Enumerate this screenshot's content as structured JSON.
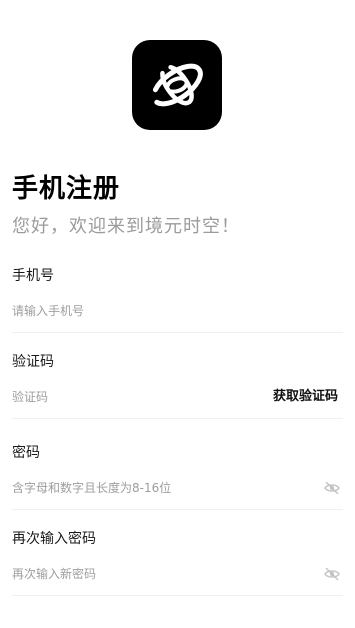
{
  "app": {
    "logo_icon": "orbit-logo-icon",
    "brand_color": "#000000"
  },
  "header": {
    "title": "手机注册",
    "subtitle": "您好，欢迎来到境元时空！"
  },
  "form": {
    "phone": {
      "label": "手机号",
      "placeholder": "请输入手机号",
      "value": ""
    },
    "code": {
      "label": "验证码",
      "placeholder": "验证码",
      "value": "",
      "action_label": "获取验证码"
    },
    "password": {
      "label": "密码",
      "placeholder": "含字母和数字且长度为8-16位",
      "value": "",
      "toggle_icon": "eye-hidden-icon"
    },
    "confirm_password": {
      "label": "再次输入密码",
      "placeholder": "再次输入新密码",
      "value": "",
      "toggle_icon": "eye-hidden-icon"
    }
  },
  "colors": {
    "subtitle": "#9b9b9b",
    "placeholder": "#9e9e9e",
    "divider": "#f0f0f0",
    "icon_gray": "#c4c4c4"
  }
}
